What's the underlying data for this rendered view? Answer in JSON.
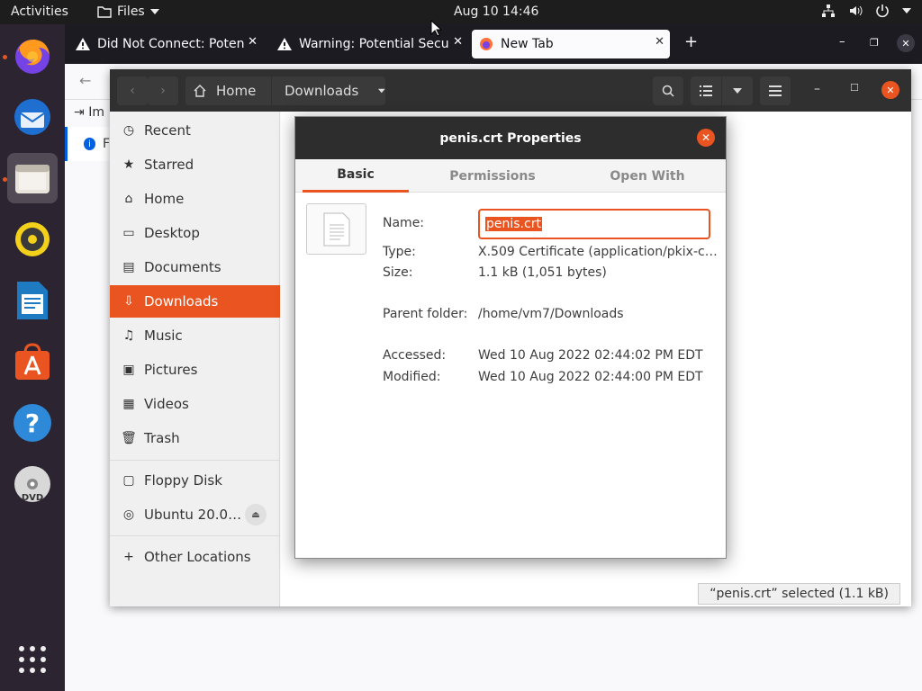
{
  "topbar": {
    "activities": "Activities",
    "app_menu": "Files",
    "clock": "Aug 10  14:46"
  },
  "dock": {
    "items": [
      "firefox-icon",
      "thunderbird-icon",
      "files-icon",
      "rhythmbox-icon",
      "writer-icon",
      "software-icon",
      "help-icon",
      "dvd-icon",
      "app-grid-icon"
    ]
  },
  "firefox": {
    "tabs": [
      {
        "label": "Did Not Connect: Potenti"
      },
      {
        "label": "Warning: Potential Securi"
      },
      {
        "label": "New Tab"
      }
    ],
    "partial_1": "Im",
    "partial_2": "F"
  },
  "nautilus": {
    "breadcrumb": {
      "home": "Home",
      "current": "Downloads"
    },
    "sidebar": [
      {
        "label": "Recent"
      },
      {
        "label": "Starred"
      },
      {
        "label": "Home"
      },
      {
        "label": "Desktop"
      },
      {
        "label": "Documents"
      },
      {
        "label": "Downloads"
      },
      {
        "label": "Music"
      },
      {
        "label": "Pictures"
      },
      {
        "label": "Videos"
      },
      {
        "label": "Trash"
      },
      {
        "label": "Floppy Disk"
      },
      {
        "label": "Ubuntu 20.0…"
      },
      {
        "label": "Other Locations"
      }
    ],
    "status": "“penis.crt” selected  (1.1 kB)"
  },
  "dialog": {
    "title": "penis.crt Properties",
    "tabs": [
      "Basic",
      "Permissions",
      "Open With"
    ],
    "name_label": "Name:",
    "name_value": "penis.crt",
    "type_label": "Type:",
    "type_value": "X.509 Certificate (application/pkix-c…",
    "size_label": "Size:",
    "size_value": "1.1 kB (1,051 bytes)",
    "parent_label": "Parent folder:",
    "parent_value": "/home/vm7/Downloads",
    "accessed_label": "Accessed:",
    "accessed_value": "Wed 10 Aug 2022 02:44:02 PM EDT",
    "modified_label": "Modified:",
    "modified_value": "Wed 10 Aug 2022 02:44:00 PM EDT"
  },
  "colors": {
    "accent": "#e95420",
    "dock": "#2c2430",
    "header": "#303030"
  }
}
